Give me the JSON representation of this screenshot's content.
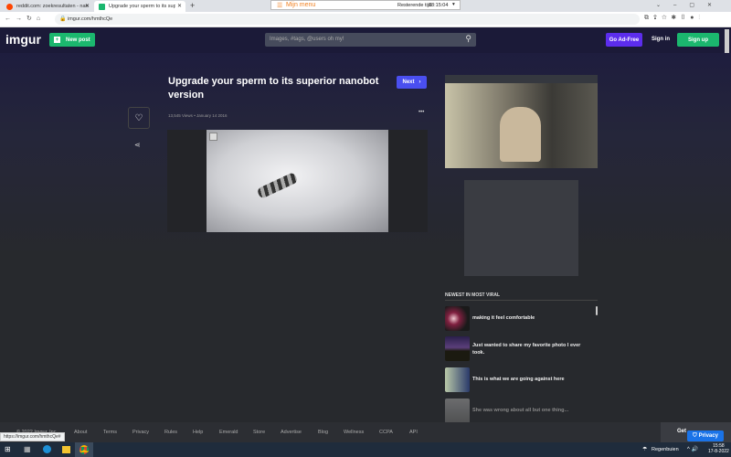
{
  "browser": {
    "tabs": [
      {
        "title": "reddit.com: zoekresultaten - nan",
        "active": false
      },
      {
        "title": "Upgrade your sperm to its superi",
        "active": true
      }
    ],
    "new_tab": "+",
    "menu": {
      "label": "Mijn menu",
      "timer_label": "Resterende tijd:",
      "timer": "18:15:04"
    },
    "url": "imgur.com/hmthcQe",
    "status_url": "https://imgur.com/hmthcQe#"
  },
  "header": {
    "logo": "imgur",
    "new_post": "New post",
    "search_placeholder": "Images, #tags, @users oh my!",
    "go_ad_free": "Go Ad-Free",
    "sign_in": "Sign in",
    "sign_up": "Sign up"
  },
  "post": {
    "title": "Upgrade your sperm to its superior nanobot version",
    "next": "Next",
    "views": "13,545 Views",
    "date": "January 14 2016",
    "more": "•••"
  },
  "sidebar": {
    "heading": "NEWEST IN MOST VIRAL",
    "items": [
      {
        "title": "making it feel comfortable"
      },
      {
        "title": "Just wanted to share my favorite photo I ever took."
      },
      {
        "title": "This is what we are going against here"
      },
      {
        "title": "She was wrong about all but one thing..."
      }
    ]
  },
  "footer": {
    "copyright": "© 2022 Imgur, Inc",
    "links": [
      "About",
      "Terms",
      "Privacy",
      "Rules",
      "Help",
      "Emerald",
      "Store",
      "Advertise",
      "Blog",
      "Wellness",
      "CCPA",
      "API"
    ],
    "get_app": "Get",
    "privacy_btn": "Privacy"
  },
  "taskbar": {
    "weather": "Regenbuien",
    "time": "15:58",
    "date": "17-8-2022"
  },
  "colors": {
    "header_bg": "#1b1a38",
    "green": "#1bb76e",
    "purple": "#5c2ded",
    "next_blue": "#4a4ff0"
  }
}
